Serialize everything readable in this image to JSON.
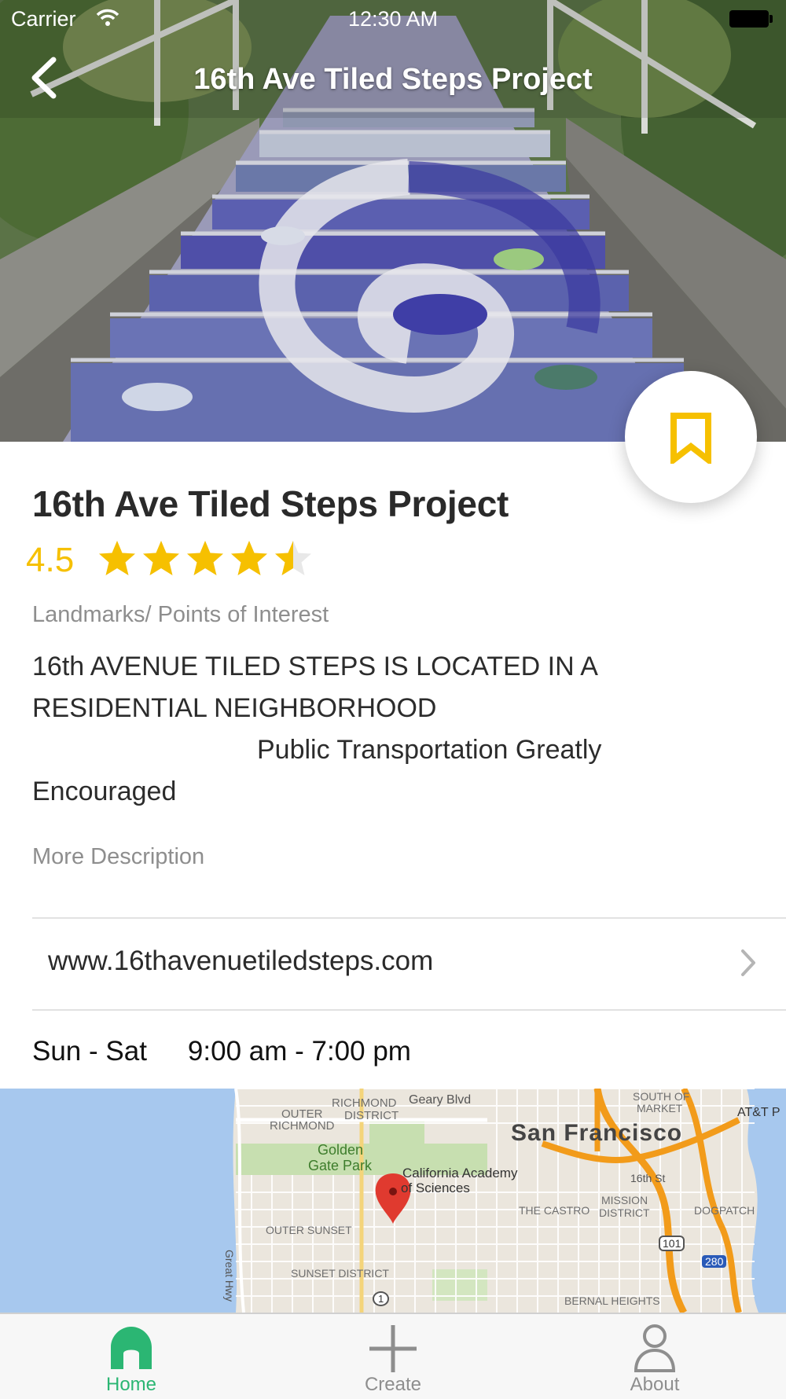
{
  "status_bar": {
    "carrier": "Carrier",
    "time": "12:30 AM"
  },
  "nav": {
    "title": "16th Ave Tiled Steps Project"
  },
  "place": {
    "title": "16th Ave Tiled Steps Project",
    "rating": "4.5",
    "rating_value": 4.5,
    "rating_max": 5,
    "category": "Landmarks/ Points of Interest",
    "description_lines": [
      "16th AVENUE TILED STEPS IS LOCATED IN A",
      "RESIDENTIAL NEIGHBORHOOD",
      "Public Transportation Greatly",
      "Encouraged"
    ],
    "more_description": "More Description",
    "website": "www.16thavenuetiledsteps.com",
    "hours_days": "Sun - Sat",
    "hours_time": "9:00 am - 7:00 pm"
  },
  "map": {
    "labels": {
      "richmond_district": "RICHMOND",
      "richmond_district_2": "DISTRICT",
      "outer_richmond": "OUTER",
      "outer_richmond_2": "RICHMOND",
      "geary": "Geary Blvd",
      "south_of_market": "SOUTH OF",
      "south_of_market_2": "MARKET",
      "att_park": "AT&T P",
      "san_francisco": "San Francisco",
      "golden_gate_park": "Golden",
      "golden_gate_park_2": "Gate Park",
      "cal_academy": "California Academy",
      "cal_academy_2": "of Sciences",
      "sixteenth_st": "16th St",
      "castro": "THE CASTRO",
      "mission_district": "MISSION",
      "mission_district_2": "DISTRICT",
      "dogpatch": "DOGPATCH",
      "great_hwy": "Great Hwy",
      "outer_sunset": "OUTER SUNSET",
      "hwy_101": "101",
      "hwy_280": "280",
      "sunset_district": "SUNSET DISTRICT",
      "hwy_1": "1",
      "bernal_heights": "BERNAL HEIGHTS"
    }
  },
  "tabs": [
    {
      "label": "Home",
      "active": true
    },
    {
      "label": "Create",
      "active": false
    },
    {
      "label": "About",
      "active": false
    }
  ],
  "colors": {
    "accent_yellow": "#f6c000",
    "tab_active": "#2bb673",
    "tab_inactive": "#8e8e8e",
    "secondary_text": "#8e8e8e"
  },
  "icons": {
    "back": "chevron-left-icon",
    "bookmark": "bookmark-icon",
    "star": "star-icon",
    "chevron": "chevron-right-icon",
    "map_pin": "map-pin-icon",
    "home": "home-icon",
    "create": "plus-icon",
    "about": "person-icon"
  }
}
